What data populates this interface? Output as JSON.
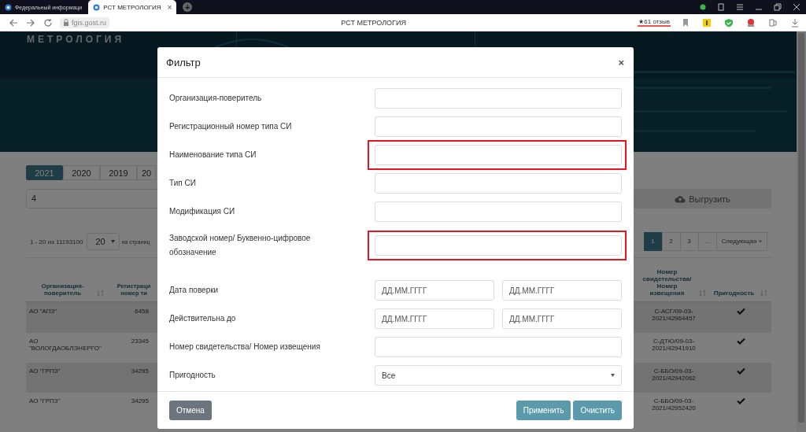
{
  "browser": {
    "tabs": [
      {
        "title": "Федеральный информаци",
        "selected": false
      },
      {
        "title": "РСТ МЕТРОЛОГИЯ",
        "selected": true
      }
    ],
    "tab_close": "×",
    "new_tab": "+",
    "url": "fgis.gost.ru",
    "page_title": "РСТ МЕТРОЛОГИЯ",
    "reviews": "★61 отзыв"
  },
  "header": {
    "logo": "МЕТРОЛОГИЯ"
  },
  "years": [
    {
      "label": "2021",
      "selected": true
    },
    {
      "label": "2020",
      "selected": false
    },
    {
      "label": "2019",
      "selected": false
    },
    {
      "label": "20",
      "selected": false
    }
  ],
  "search": {
    "value": "4"
  },
  "export_button": "Выгрузить",
  "results": {
    "range": "1 - 20 из 11193100",
    "per_page": "20",
    "per_page_label": "на страниц"
  },
  "pager": [
    {
      "label": "1",
      "selected": true
    },
    {
      "label": "2",
      "selected": false
    },
    {
      "label": "3",
      "selected": false
    },
    {
      "label": "…",
      "selected": false
    },
    {
      "label": "Следующая »",
      "selected": false
    }
  ],
  "table": {
    "columns": [
      "Организация-поверитель",
      "Регистраци номер ти",
      "Номер свидетельства/ Номер извещения",
      "Пригодность"
    ],
    "rows": [
      {
        "org": "АО \"АПЗ\"",
        "reg": "6458",
        "cert": "С-АСГ/09-03-2021/42964457",
        "fit": true
      },
      {
        "org": "АО \"ВОЛОГДАОБЛЭНЕРГО\"",
        "reg": "23345",
        "cert": "С-ДТЮ/09-03-2021/42941910",
        "fit": true
      },
      {
        "org": "АО \"ГРПЗ\"",
        "reg": "34295",
        "cert": "С-ББО/09-03-2021/42942062",
        "fit": true
      },
      {
        "org": "АО \"ГРПЗ\"",
        "reg": "34295",
        "cert": "С-ББО/09-03-2021/42952420",
        "fit": true
      }
    ]
  },
  "modal": {
    "title": "Фильтр",
    "close": "×",
    "fields": [
      {
        "label": "Организация-поверитель",
        "kind": "text",
        "highlighted": false
      },
      {
        "label": "Регистрационный номер типа СИ",
        "kind": "text",
        "highlighted": false
      },
      {
        "label": "Наименование типа СИ",
        "kind": "text",
        "highlighted": true
      },
      {
        "label": "Тип СИ",
        "kind": "text",
        "highlighted": false
      },
      {
        "label": "Модификация СИ",
        "kind": "text",
        "highlighted": false
      },
      {
        "label": "Заводской номер/ Буквенно-цифровое обозначение",
        "kind": "text",
        "highlighted": true
      },
      {
        "label": "Дата поверки",
        "kind": "date_range",
        "placeholders": [
          "ДД.ММ.ГГГГ",
          "ДД.ММ.ГГГГ"
        ]
      },
      {
        "label": "Действительна до",
        "kind": "date_range",
        "placeholders": [
          "ДД.ММ.ГГГГ",
          "ДД.ММ.ГГГГ"
        ]
      },
      {
        "label": "Номер свидетельства/ Номер извещения",
        "kind": "text",
        "highlighted": false
      },
      {
        "label": "Пригодность",
        "kind": "select",
        "value": "Все"
      }
    ],
    "buttons": [
      {
        "label": "Отмена",
        "kind": "secondary"
      },
      {
        "label": "Применить",
        "kind": "primary"
      },
      {
        "label": "Очистить",
        "kind": "primary"
      }
    ]
  }
}
